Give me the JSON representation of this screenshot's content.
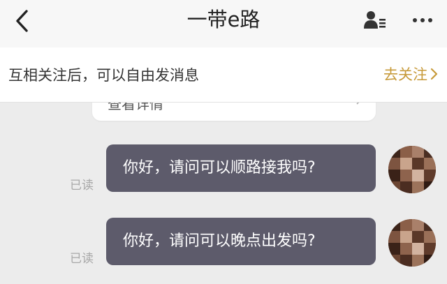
{
  "header": {
    "title": "一带e路",
    "back_icon": "chevron-left-icon",
    "profile_icon": "user-card-icon",
    "more_icon": "more-dots-icon"
  },
  "follow_bar": {
    "text": "互相关注后，可以自由发消息",
    "action_label": "去关注",
    "action_color": "#c79a3a"
  },
  "detail_card": {
    "label": "查看详情"
  },
  "messages": [
    {
      "text": "你好，请问可以顺路接我吗?",
      "status": "已读"
    },
    {
      "text": "你好，请问可以晚点出发吗?",
      "status": "已读"
    }
  ],
  "colors": {
    "bubble": "#5d5b6b",
    "background": "#ececec"
  }
}
